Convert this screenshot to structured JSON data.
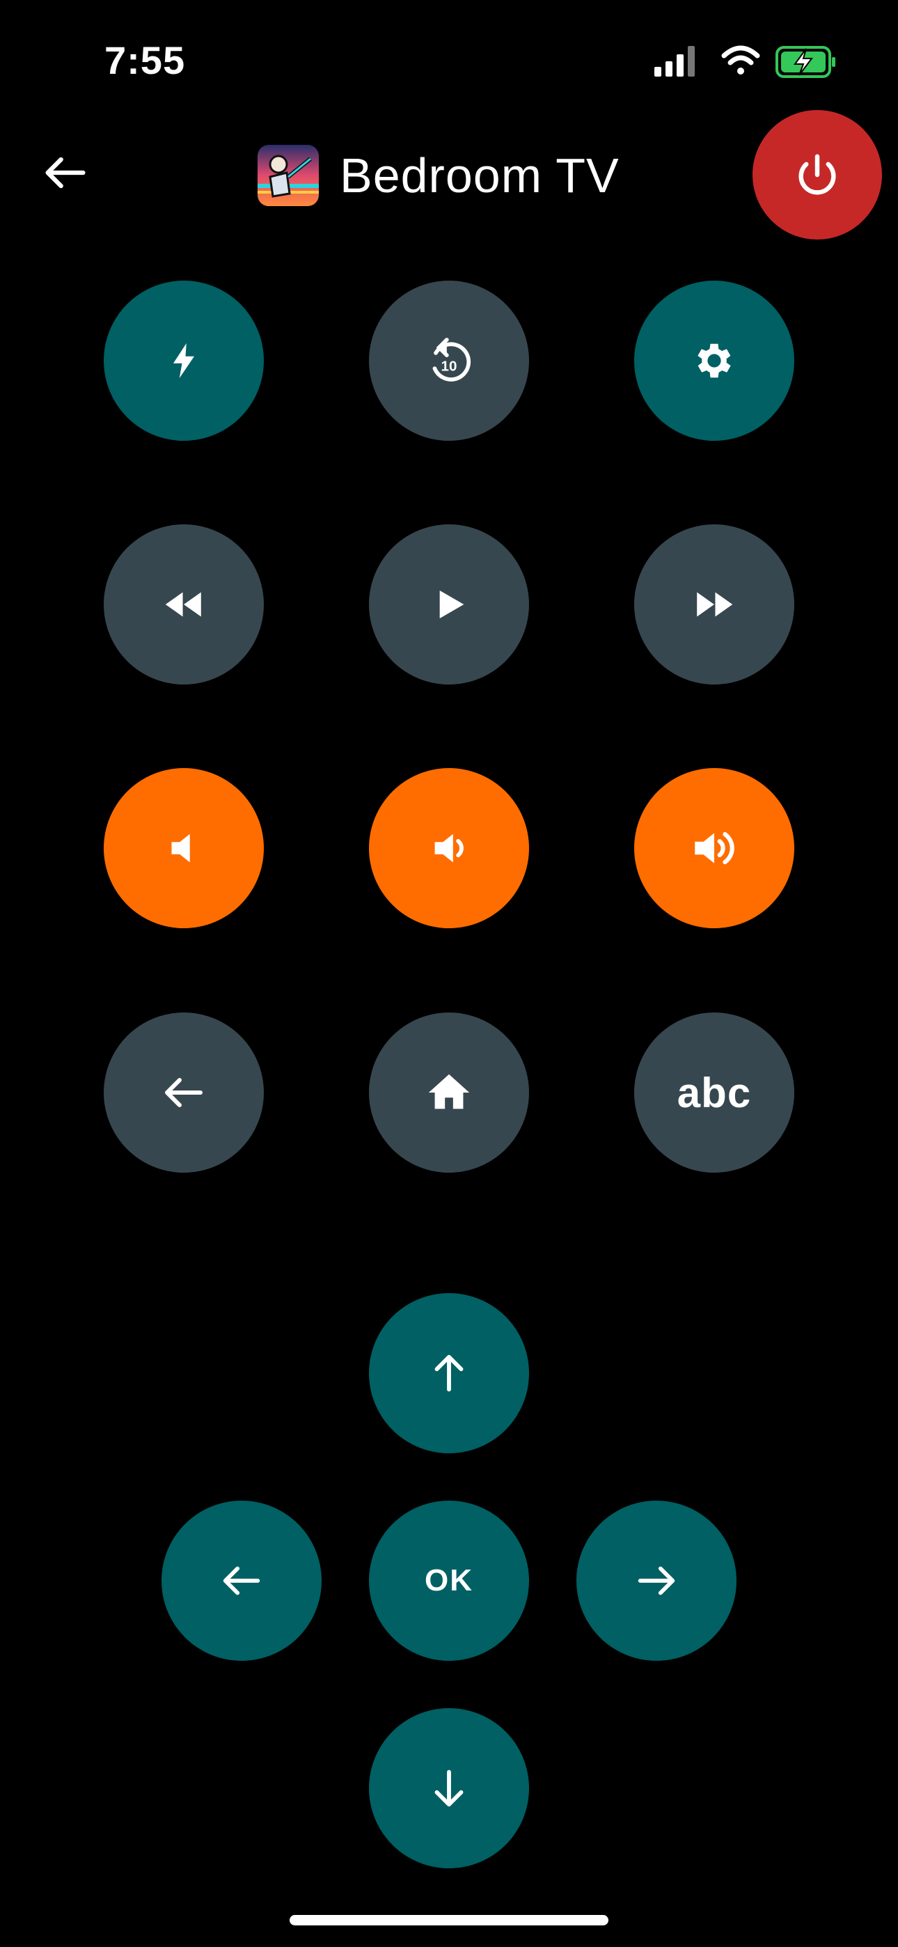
{
  "status_bar": {
    "time": "7:55",
    "icons": [
      "signal-icon",
      "wifi-icon",
      "battery-charging-icon"
    ],
    "battery_color": "#34C759"
  },
  "header": {
    "title": "Bedroom TV",
    "back_icon": "arrow-left-icon",
    "app_icon": "app-avatar-icon",
    "power_icon": "power-icon",
    "power_color": "#C62828"
  },
  "buttons": {
    "row1": [
      {
        "icon": "flash-icon",
        "color": "#006064"
      },
      {
        "icon": "replay-10-icon",
        "color": "#37474F",
        "badge": "10"
      },
      {
        "icon": "gear-icon",
        "color": "#006064"
      }
    ],
    "row2": [
      {
        "icon": "rewind-icon",
        "color": "#37474F"
      },
      {
        "icon": "play-icon",
        "color": "#37474F"
      },
      {
        "icon": "fast-forward-icon",
        "color": "#37474F"
      }
    ],
    "row3": [
      {
        "icon": "volume-mute-icon",
        "color": "#FF6D00"
      },
      {
        "icon": "volume-down-icon",
        "color": "#FF6D00"
      },
      {
        "icon": "volume-up-icon",
        "color": "#FF6D00"
      }
    ],
    "row4": [
      {
        "icon": "arrow-left-icon",
        "color": "#37474F"
      },
      {
        "icon": "home-icon",
        "color": "#37474F"
      },
      {
        "label": "abc",
        "color": "#37474F"
      }
    ]
  },
  "dpad": {
    "up_icon": "arrow-up-icon",
    "left_icon": "arrow-left-icon",
    "ok_label": "OK",
    "right_icon": "arrow-right-icon",
    "down_icon": "arrow-down-icon",
    "color": "#006064"
  }
}
